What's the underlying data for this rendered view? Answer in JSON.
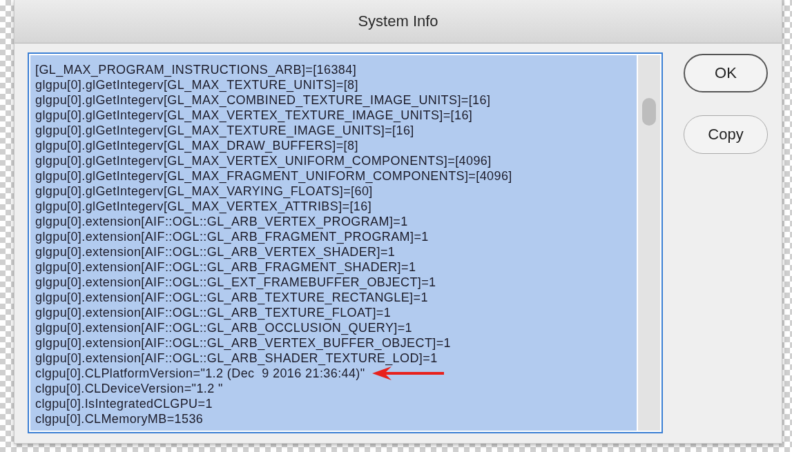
{
  "window": {
    "title": "System Info"
  },
  "info_text": {
    "selected": true,
    "lines": [
      "[GL_MAX_PROGRAM_INSTRUCTIONS_ARB]=[16384]",
      "glgpu[0].glGetIntegerv[GL_MAX_TEXTURE_UNITS]=[8]",
      "glgpu[0].glGetIntegerv[GL_MAX_COMBINED_TEXTURE_IMAGE_UNITS]=[16]",
      "glgpu[0].glGetIntegerv[GL_MAX_VERTEX_TEXTURE_IMAGE_UNITS]=[16]",
      "glgpu[0].glGetIntegerv[GL_MAX_TEXTURE_IMAGE_UNITS]=[16]",
      "glgpu[0].glGetIntegerv[GL_MAX_DRAW_BUFFERS]=[8]",
      "glgpu[0].glGetIntegerv[GL_MAX_VERTEX_UNIFORM_COMPONENTS]=[4096]",
      "glgpu[0].glGetIntegerv[GL_MAX_FRAGMENT_UNIFORM_COMPONENTS]=[4096]",
      "glgpu[0].glGetIntegerv[GL_MAX_VARYING_FLOATS]=[60]",
      "glgpu[0].glGetIntegerv[GL_MAX_VERTEX_ATTRIBS]=[16]",
      "glgpu[0].extension[AIF::OGL::GL_ARB_VERTEX_PROGRAM]=1",
      "glgpu[0].extension[AIF::OGL::GL_ARB_FRAGMENT_PROGRAM]=1",
      "glgpu[0].extension[AIF::OGL::GL_ARB_VERTEX_SHADER]=1",
      "glgpu[0].extension[AIF::OGL::GL_ARB_FRAGMENT_SHADER]=1",
      "glgpu[0].extension[AIF::OGL::GL_EXT_FRAMEBUFFER_OBJECT]=1",
      "glgpu[0].extension[AIF::OGL::GL_ARB_TEXTURE_RECTANGLE]=1",
      "glgpu[0].extension[AIF::OGL::GL_ARB_TEXTURE_FLOAT]=1",
      "glgpu[0].extension[AIF::OGL::GL_ARB_OCCLUSION_QUERY]=1",
      "glgpu[0].extension[AIF::OGL::GL_ARB_VERTEX_BUFFER_OBJECT]=1",
      "glgpu[0].extension[AIF::OGL::GL_ARB_SHADER_TEXTURE_LOD]=1",
      "clgpu[0].CLPlatformVersion=\"1.2 (Dec  9 2016 21:36:44)\"",
      "clgpu[0].CLDeviceVersion=\"1.2 \"",
      "clgpu[0].IsIntegratedCLGPU=1",
      "clgpu[0].CLMemoryMB=1536"
    ],
    "annotated_lines": [
      false,
      false,
      false,
      false,
      false,
      false,
      false,
      false,
      false,
      false,
      false,
      false,
      false,
      false,
      false,
      false,
      false,
      false,
      false,
      false,
      true,
      false,
      false,
      false
    ]
  },
  "buttons": [
    {
      "label": "OK",
      "kind": "default"
    },
    {
      "label": "Copy",
      "kind": "normal"
    }
  ]
}
